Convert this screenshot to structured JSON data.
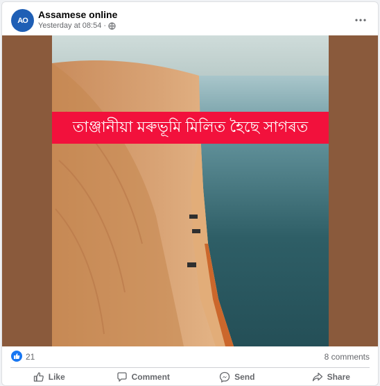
{
  "post": {
    "author": "Assamese online",
    "avatar_text": "AO",
    "timestamp": "Yesterday at 08:54",
    "separator": "·",
    "audience_icon": "globe-icon",
    "options_icon": "more-horizontal-icon"
  },
  "media": {
    "caption_text": "তাঞ্জানীয়া মৰুভূমি মিলিত হৈছে সাগৰত"
  },
  "stats": {
    "like_count": "21",
    "comment_count": "8 comments"
  },
  "actions": {
    "like_label": "Like",
    "comment_label": "Comment",
    "send_label": "Send",
    "share_label": "Share"
  },
  "colors": {
    "accent": "#1877f2",
    "banner": "#f2113c",
    "avatar_bg": "#1f5fb5"
  }
}
